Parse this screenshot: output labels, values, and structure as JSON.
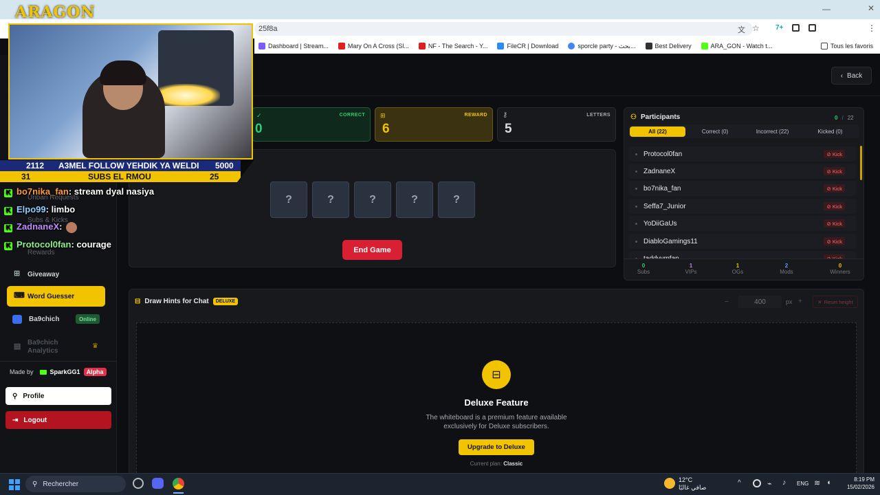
{
  "browser": {
    "address": "25f8a",
    "bookmarks": [
      {
        "label": "Dashboard | Stream...",
        "color": "#7b5cf5"
      },
      {
        "label": "Mary On A Cross (Sl...",
        "color": "#e02020"
      },
      {
        "label": "NF - The Search - Y...",
        "color": "#e02020"
      },
      {
        "label": "FileCR | Download",
        "color": "#2c8cf0"
      },
      {
        "label": "sporcle party - بحث...",
        "color": "#4285f4"
      },
      {
        "label": "Best Delivery",
        "color": "#333333"
      },
      {
        "label": "ARA_GON - Watch t...",
        "color": "#53fc18"
      }
    ],
    "all_favorites": "Tous les favoris"
  },
  "overlay": {
    "logo": "ARAGON",
    "ticker": {
      "row1_left": "2112",
      "row1_center": "A3MEL FOLLOW YEHDIK YA WELDI",
      "row1_right": "5000",
      "row2_left": "31",
      "row2_center": "SUBS EL RMOU",
      "row2_right": "25"
    },
    "chat": [
      {
        "user": "bo7nika_fan",
        "text": ": stream dyal nasiya",
        "color": "#ff9a3c"
      },
      {
        "user": "Elpo99",
        "text": ": limbo",
        "color": "#8ed0ff"
      },
      {
        "user": "ZadnaneX",
        "text": ":",
        "color": "#c08cff"
      },
      {
        "user": "Protocol0fan",
        "text": ": courage",
        "color": "#8ef08e"
      }
    ]
  },
  "sidebar": {
    "hidden_items": [
      "Unban Requests",
      "Subs & Kicks",
      "Rewards"
    ],
    "items": [
      {
        "label": "Giveaway",
        "icon": "gift-icon"
      },
      {
        "label": "Word Guesser",
        "icon": "word-icon",
        "active": true
      },
      {
        "label": "Ba9chich",
        "icon": "ba9chich-icon",
        "badge": "Online"
      },
      {
        "label": "Ba9chich Analytics",
        "icon": "chart-icon",
        "dimmed": true
      }
    ],
    "made_by_prefix": "Made by",
    "made_by_name": "SparkGG1",
    "made_by_badge": "Alpha",
    "profile_label": "Profile",
    "logout_label": "Logout"
  },
  "header": {
    "back_label": "Back"
  },
  "stats": {
    "correct_label": "CORRECT",
    "correct_value": "0",
    "reward_label": "REWARD",
    "reward_value": "6",
    "letters_label": "LETTERS",
    "letters_value": "5"
  },
  "game": {
    "hidden_letters": [
      "?",
      "?",
      "?",
      "?",
      "?"
    ],
    "end_game_label": "End Game"
  },
  "participants": {
    "title": "Participants",
    "count_correct": "0",
    "count_sep": "/",
    "count_total": "22",
    "tabs": [
      "All (22)",
      "Correct (0)",
      "Incorrect (22)",
      "Kicked (0)"
    ],
    "list": [
      "Protocol0fan",
      "ZadnaneX",
      "bo7nika_fan",
      "Seffa7_Junior",
      "YoDiiGaUs",
      "DiabloGamings11",
      "taddyvmfan"
    ],
    "kick_label": "Kick",
    "summary": [
      {
        "value": "0",
        "label": "Subs",
        "color": "#2ecc71"
      },
      {
        "value": "1",
        "label": "VIPs",
        "color": "#c77dff"
      },
      {
        "value": "1",
        "label": "OGs",
        "color": "#f2c400"
      },
      {
        "value": "2",
        "label": "Mods",
        "color": "#4da3ff"
      },
      {
        "value": "0",
        "label": "Winners",
        "color": "#f2c400"
      }
    ]
  },
  "hints": {
    "title": "Draw Hints for Chat",
    "badge": "DELUXE",
    "height_minus": "−",
    "height_value": "400",
    "height_unit": "px",
    "height_plus": "+",
    "reset_label": "Reset height",
    "deluxe_title": "Deluxe Feature",
    "deluxe_desc_1": "The whiteboard is a premium feature available",
    "deluxe_desc_2": "exclusively for Deluxe subscribers.",
    "upgrade_label": "Upgrade to Deluxe",
    "plan_prefix": "Current plan:",
    "plan_name": "Classic"
  },
  "taskbar": {
    "search_placeholder": "Rechercher",
    "weather_temp": "12°C",
    "weather_desc": "صافي غالبًا",
    "lang": "ENG",
    "time": "8:19 PM",
    "date": "15/02/2026"
  }
}
